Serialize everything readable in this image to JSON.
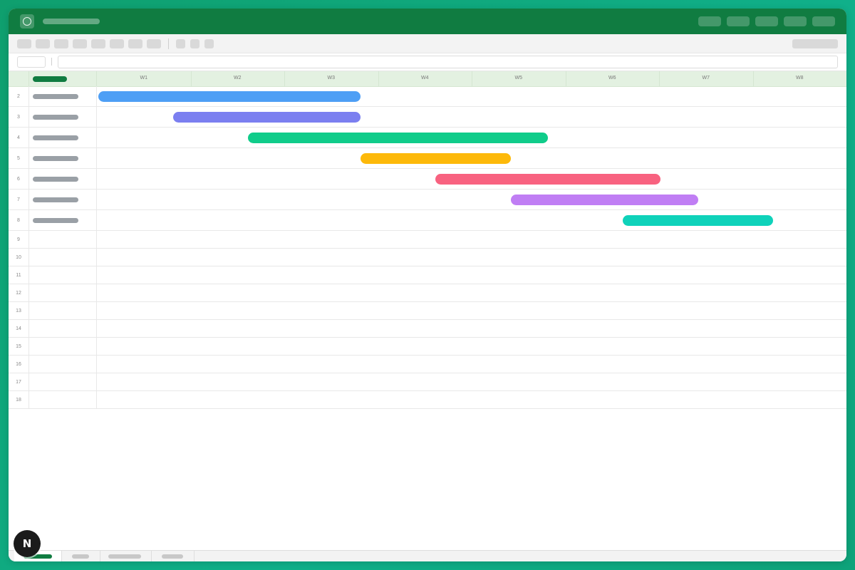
{
  "weeks": [
    "W1",
    "W2",
    "W3",
    "W4",
    "W5",
    "W6",
    "W7",
    "W8"
  ],
  "rows": [
    {
      "num": "2",
      "has_task": true,
      "bar": {
        "start": 0.0,
        "end": 2.8,
        "color": "#4e9ff5"
      }
    },
    {
      "num": "3",
      "has_task": true,
      "bar": {
        "start": 0.8,
        "end": 2.8,
        "color": "#7b7ff0"
      }
    },
    {
      "num": "4",
      "has_task": true,
      "bar": {
        "start": 1.6,
        "end": 4.8,
        "color": "#10cc8a"
      }
    },
    {
      "num": "5",
      "has_task": true,
      "bar": {
        "start": 2.8,
        "end": 4.4,
        "color": "#fdb90a"
      }
    },
    {
      "num": "6",
      "has_task": true,
      "bar": {
        "start": 3.6,
        "end": 6.0,
        "color": "#f86280"
      }
    },
    {
      "num": "7",
      "has_task": true,
      "bar": {
        "start": 4.4,
        "end": 6.4,
        "color": "#c07ef4"
      }
    },
    {
      "num": "8",
      "has_task": true,
      "bar": {
        "start": 5.6,
        "end": 7.2,
        "color": "#0fd2ba"
      }
    },
    {
      "num": "9",
      "has_task": false
    },
    {
      "num": "10",
      "has_task": false
    },
    {
      "num": "11",
      "has_task": false
    },
    {
      "num": "12",
      "has_task": false
    },
    {
      "num": "13",
      "has_task": false
    },
    {
      "num": "14",
      "has_task": false
    },
    {
      "num": "15",
      "has_task": false
    },
    {
      "num": "16",
      "has_task": false
    },
    {
      "num": "17",
      "has_task": false
    },
    {
      "num": "18",
      "has_task": false
    }
  ],
  "badge": {
    "letter": "N"
  },
  "colors": {
    "accent": "#107c41",
    "header_bg": "#e3f1e1"
  }
}
